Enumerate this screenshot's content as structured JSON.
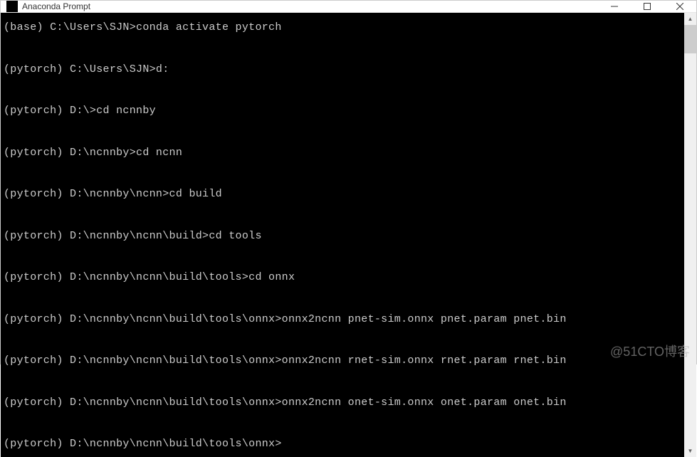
{
  "window": {
    "title": "Anaconda Prompt"
  },
  "terminal": {
    "lines": [
      {
        "prompt": "(base) C:\\Users\\SJN>",
        "cmd": "conda activate pytorch"
      },
      {
        "prompt": "(pytorch) C:\\Users\\SJN>",
        "cmd": "d:"
      },
      {
        "prompt": "(pytorch) D:\\>",
        "cmd": "cd ncnnby"
      },
      {
        "prompt": "(pytorch) D:\\ncnnby>",
        "cmd": "cd ncnn"
      },
      {
        "prompt": "(pytorch) D:\\ncnnby\\ncnn>",
        "cmd": "cd build"
      },
      {
        "prompt": "(pytorch) D:\\ncnnby\\ncnn\\build>",
        "cmd": "cd tools"
      },
      {
        "prompt": "(pytorch) D:\\ncnnby\\ncnn\\build\\tools>",
        "cmd": "cd onnx"
      },
      {
        "prompt": "(pytorch) D:\\ncnnby\\ncnn\\build\\tools\\onnx>",
        "cmd": "onnx2ncnn pnet-sim.onnx pnet.param pnet.bin"
      },
      {
        "prompt": "(pytorch) D:\\ncnnby\\ncnn\\build\\tools\\onnx>",
        "cmd": "onnx2ncnn rnet-sim.onnx rnet.param rnet.bin"
      },
      {
        "prompt": "(pytorch) D:\\ncnnby\\ncnn\\build\\tools\\onnx>",
        "cmd": "onnx2ncnn onet-sim.onnx onet.param onet.bin"
      },
      {
        "prompt": "(pytorch) D:\\ncnnby\\ncnn\\build\\tools\\onnx>",
        "cmd": ""
      }
    ]
  },
  "watermark": "@51CTO博客"
}
